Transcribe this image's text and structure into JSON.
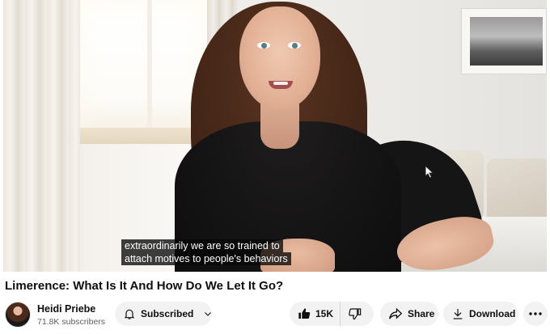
{
  "video": {
    "captions": [
      "extraordinarily we are so trained to",
      "attach motives to people's behaviors"
    ]
  },
  "title": "Limerence: What Is It And How Do We Let It Go?",
  "channel": {
    "name": "Heidi Priebe",
    "subscribers": "71.8K subscribers"
  },
  "actions": {
    "subscribe_label": "Subscribed",
    "like_count": "15K",
    "share_label": "Share",
    "download_label": "Download"
  },
  "icons": {
    "subscribe": "bell-icon",
    "subscribe_menu": "chevron-down-icon",
    "like": "thumbs-up-icon",
    "dislike": "thumbs-down-icon",
    "share": "share-arrow-icon",
    "download": "download-icon",
    "more": "more-horizontal-icon",
    "cursor": "mouse-pointer-icon"
  }
}
